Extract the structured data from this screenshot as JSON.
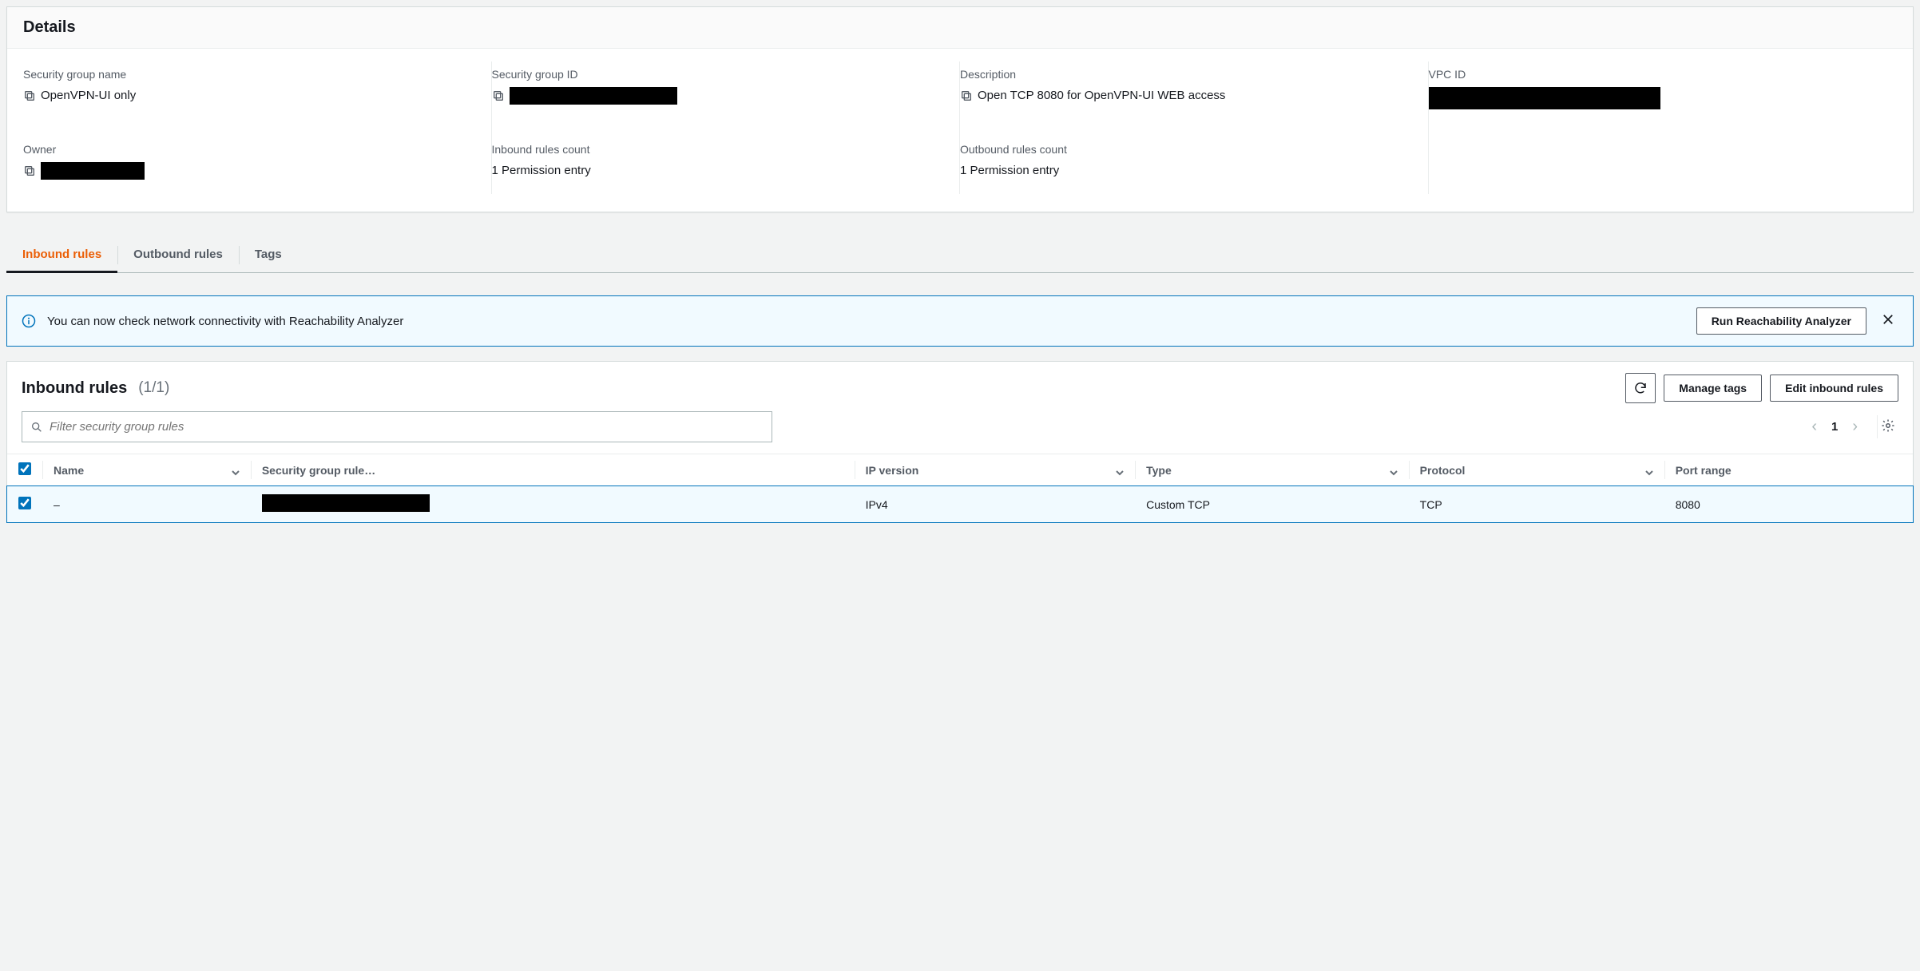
{
  "details": {
    "panel_title": "Details",
    "fields": {
      "sg_name": {
        "label": "Security group name",
        "value": "OpenVPN-UI only"
      },
      "sg_id": {
        "label": "Security group ID"
      },
      "desc": {
        "label": "Description",
        "value": "Open TCP 8080 for OpenVPN-UI WEB access"
      },
      "vpc_id": {
        "label": "VPC ID"
      },
      "owner": {
        "label": "Owner"
      },
      "inbound_count": {
        "label": "Inbound rules count",
        "value": "1 Permission entry"
      },
      "outbound_count": {
        "label": "Outbound rules count",
        "value": "1 Permission entry"
      }
    }
  },
  "tabs": {
    "inbound": "Inbound rules",
    "outbound": "Outbound rules",
    "tags": "Tags"
  },
  "banner": {
    "text": "You can now check network connectivity with Reachability Analyzer",
    "button": "Run Reachability Analyzer"
  },
  "rules_panel": {
    "title": "Inbound rules",
    "count": "(1/1)",
    "manage_tags_btn": "Manage tags",
    "edit_rules_btn": "Edit inbound rules",
    "filter_placeholder": "Filter security group rules",
    "page": "1",
    "columns": {
      "name": "Name",
      "rule_id": "Security group rule…",
      "ip_version": "IP version",
      "type": "Type",
      "protocol": "Protocol",
      "port_range": "Port range"
    },
    "rows": [
      {
        "selected": true,
        "name": "–",
        "rule_id_redacted": true,
        "ip_version": "IPv4",
        "type": "Custom TCP",
        "protocol": "TCP",
        "port_range": "8080"
      }
    ]
  }
}
